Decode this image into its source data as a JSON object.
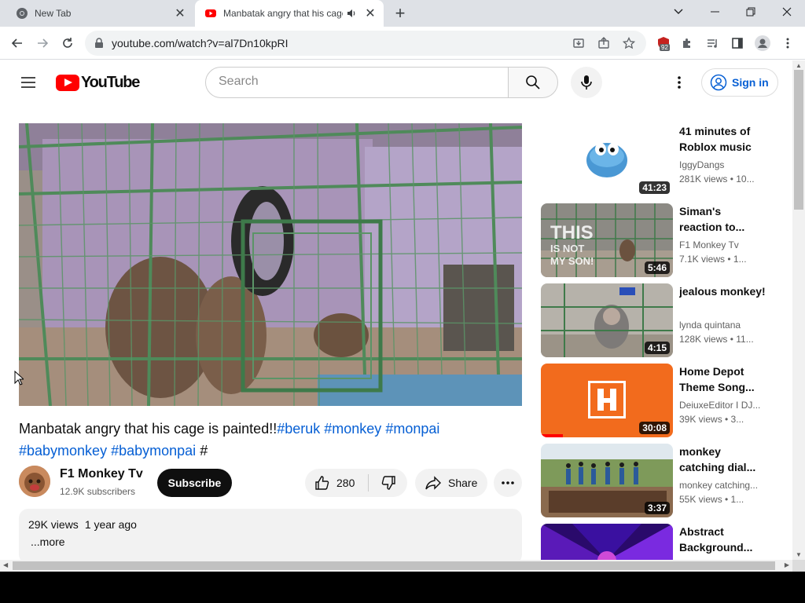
{
  "browser": {
    "tabs": [
      {
        "label": "New Tab",
        "active": false
      },
      {
        "label": "Manbatak angry that his cage",
        "active": true
      }
    ],
    "url": "youtube.com/watch?v=al7Dn10kpRI",
    "extension_badge": "92"
  },
  "youtube": {
    "logo_text": "YouTube",
    "search_placeholder": "Search",
    "signin_label": "Sign in",
    "video": {
      "title": "Manbatak angry that his cage is painted!!",
      "hashtags": [
        "#beruk",
        "#monkey",
        "#monpai",
        "#babymonkey",
        "#babymonpai",
        "#"
      ],
      "channel": "F1 Monkey Tv",
      "subscribers": "12.9K subscribers",
      "subscribe_label": "Subscribe",
      "likes": "280",
      "share_label": "Share",
      "views": "29K views",
      "age": "1 year ago",
      "more_label": "...more"
    },
    "recommendations": [
      {
        "title": "41 minutes of Roblox music",
        "channel": "IggyDangs",
        "meta": "281K views • 10...",
        "duration": "41:23"
      },
      {
        "title": "Siman's reaction to...",
        "channel": "F1 Monkey Tv",
        "meta": "7.1K views • 1...",
        "duration": "5:46"
      },
      {
        "title": "jealous monkey!",
        "channel": "lynda quintana",
        "meta": "128K views • 11...",
        "duration": "4:15"
      },
      {
        "title": "Home Depot Theme Song...",
        "channel": "DeiuxeEditor I DJ...",
        "meta": "39K views • 3...",
        "duration": "30:08"
      },
      {
        "title": "monkey catching dial...",
        "channel": "monkey catching...",
        "meta": "55K views • 1...",
        "duration": "3:37"
      },
      {
        "title": "Abstract Background...",
        "channel": "",
        "meta": "",
        "duration": ""
      }
    ]
  },
  "colors": {
    "youtube_red": "#ff0000",
    "link_blue": "#065fd4",
    "tab_strip": "#dee1e6"
  }
}
